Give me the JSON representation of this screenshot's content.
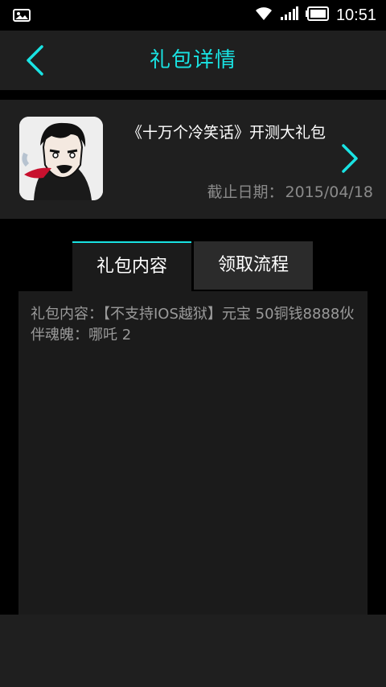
{
  "status_bar": {
    "time": "10:51",
    "icons": [
      "image-notification-icon",
      "wifi-icon",
      "cell-signal-icon",
      "battery-icon"
    ]
  },
  "header": {
    "title": "礼包详情",
    "back_icon": "chevron-left-icon"
  },
  "gift": {
    "name": "《十万个冷笑话》开测大礼包",
    "deadline_label": "截止日期：",
    "deadline_value": "2015/04/18",
    "arrow_icon": "chevron-right-icon"
  },
  "tabs": [
    {
      "label": "礼包内容",
      "active": true
    },
    {
      "label": "领取流程",
      "active": false
    }
  ],
  "content": {
    "text": "礼包内容：【不支持IOS越狱】元宝 50铜钱8888伙伴魂魄：哪吒 2"
  },
  "colors": {
    "accent": "#19e3e3",
    "panel": "#1f1f1f",
    "background": "#000000",
    "muted_text": "#8a8a8a"
  }
}
